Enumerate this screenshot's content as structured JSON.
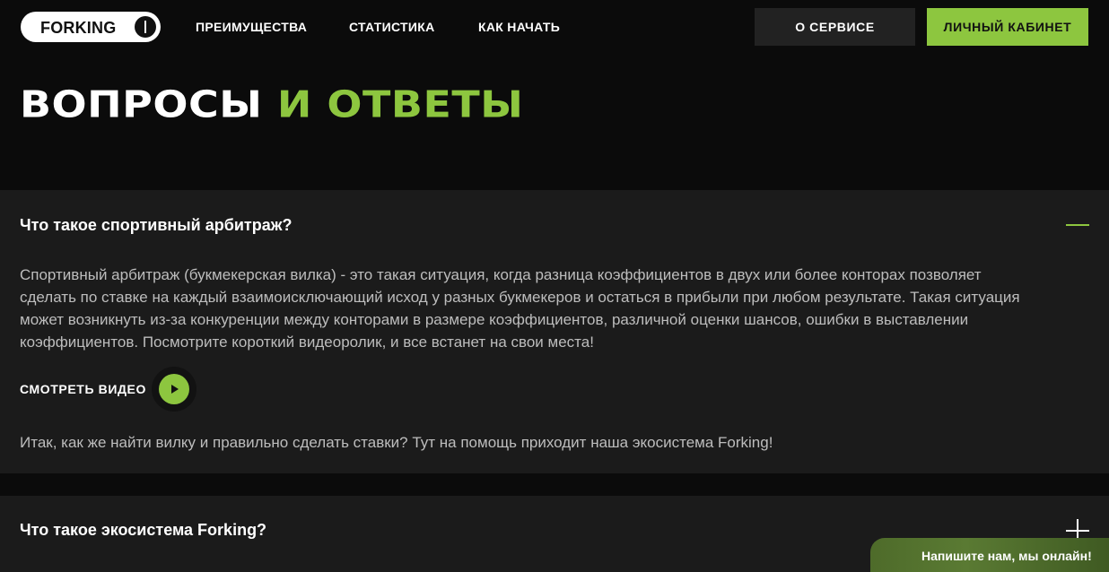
{
  "header": {
    "logo_text": "FORKING",
    "nav": [
      "ПРЕИМУЩЕСТВА",
      "СТАТИСТИКА",
      "КАК НАЧАТЬ"
    ],
    "about_button": "О СЕРВИСЕ",
    "cabinet_button": "ЛИЧНЫЙ КАБИНЕТ"
  },
  "page": {
    "title_part1": "ВОПРОСЫ",
    "title_part2": "И ОТВЕТЫ"
  },
  "faq": [
    {
      "question": "Что такое спортивный арбитраж?",
      "expanded": true,
      "answer": "Спортивный арбитраж (букмекерская вилка) - это такая ситуация, когда разница коэффициентов в двух или более конторах позволяет сделать по ставке на каждый взаимоисключающий исход у разных букмекеров и остаться в прибыли при любом результате. Такая ситуация может возникнуть из-за конкуренции между конторами в размере коэффициентов, различной оценки шансов, ошибки в выставлении коэффициентов. Посмотрите короткий видеоролик, и все встанет на свои места!",
      "video_label": "СМОТРЕТЬ ВИДЕО",
      "followup": "Итак, как же найти вилку и правильно сделать ставки? Тут на помощь приходит наша экосистема Forking!"
    },
    {
      "question": "Что такое экосистема Forking?",
      "expanded": false
    }
  ],
  "chat": {
    "label": "Напишите нам, мы онлайн!"
  },
  "colors": {
    "accent": "#8dc63f",
    "background": "#0b0b0b",
    "panel": "#1b1b1b",
    "button_dark": "#222222"
  },
  "icons": {
    "collapse": "minus-icon",
    "expand": "plus-icon",
    "video": "play-icon",
    "logo_toggle": "power-toggle-icon"
  }
}
